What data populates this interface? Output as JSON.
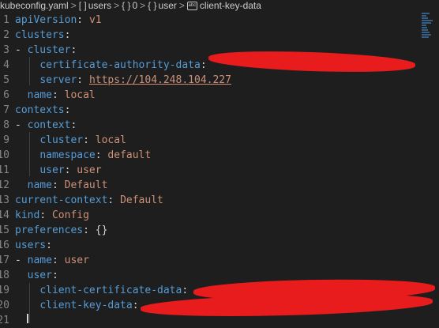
{
  "breadcrumb": {
    "file": "kubeconfig.yaml",
    "items": [
      {
        "symbol": "[ ]",
        "label": "users"
      },
      {
        "symbol": "{ }",
        "label": "0"
      },
      {
        "symbol": "{ }",
        "label": "user"
      },
      {
        "symbol": "abc",
        "label": "client-key-data"
      }
    ]
  },
  "lines": [
    {
      "num": "1",
      "parts": [
        {
          "t": "k",
          "s": "apiVersion"
        },
        {
          "t": "p",
          "s": ": "
        },
        {
          "t": "v",
          "s": "v1"
        }
      ]
    },
    {
      "num": "2",
      "parts": [
        {
          "t": "k",
          "s": "clusters"
        },
        {
          "t": "p",
          "s": ":"
        }
      ]
    },
    {
      "num": "3",
      "parts": [
        {
          "t": "p",
          "s": "- "
        },
        {
          "t": "k",
          "s": "cluster"
        },
        {
          "t": "p",
          "s": ":"
        }
      ]
    },
    {
      "num": "4",
      "parts": [
        {
          "t": "p",
          "s": "    "
        },
        {
          "t": "k",
          "s": "certificate-authority-data"
        },
        {
          "t": "p",
          "s": ":"
        }
      ]
    },
    {
      "num": "5",
      "parts": [
        {
          "t": "p",
          "s": "    "
        },
        {
          "t": "k",
          "s": "server"
        },
        {
          "t": "p",
          "s": ": "
        },
        {
          "t": "u",
          "s": "https://104.248.104.227"
        }
      ]
    },
    {
      "num": "6",
      "parts": [
        {
          "t": "p",
          "s": "  "
        },
        {
          "t": "k",
          "s": "name"
        },
        {
          "t": "p",
          "s": ": "
        },
        {
          "t": "v",
          "s": "local"
        }
      ]
    },
    {
      "num": "7",
      "parts": [
        {
          "t": "k",
          "s": "contexts"
        },
        {
          "t": "p",
          "s": ":"
        }
      ]
    },
    {
      "num": "8",
      "parts": [
        {
          "t": "p",
          "s": "- "
        },
        {
          "t": "k",
          "s": "context"
        },
        {
          "t": "p",
          "s": ":"
        }
      ]
    },
    {
      "num": "9",
      "parts": [
        {
          "t": "p",
          "s": "    "
        },
        {
          "t": "k",
          "s": "cluster"
        },
        {
          "t": "p",
          "s": ": "
        },
        {
          "t": "v",
          "s": "local"
        }
      ]
    },
    {
      "num": "10",
      "parts": [
        {
          "t": "p",
          "s": "    "
        },
        {
          "t": "k",
          "s": "namespace"
        },
        {
          "t": "p",
          "s": ": "
        },
        {
          "t": "v",
          "s": "default"
        }
      ]
    },
    {
      "num": "11",
      "parts": [
        {
          "t": "p",
          "s": "    "
        },
        {
          "t": "k",
          "s": "user"
        },
        {
          "t": "p",
          "s": ": "
        },
        {
          "t": "v",
          "s": "user"
        }
      ]
    },
    {
      "num": "12",
      "parts": [
        {
          "t": "p",
          "s": "  "
        },
        {
          "t": "k",
          "s": "name"
        },
        {
          "t": "p",
          "s": ": "
        },
        {
          "t": "v",
          "s": "Default"
        }
      ]
    },
    {
      "num": "13",
      "parts": [
        {
          "t": "k",
          "s": "current-context"
        },
        {
          "t": "p",
          "s": ": "
        },
        {
          "t": "v",
          "s": "Default"
        }
      ]
    },
    {
      "num": "14",
      "parts": [
        {
          "t": "k",
          "s": "kind"
        },
        {
          "t": "p",
          "s": ": "
        },
        {
          "t": "v",
          "s": "Config"
        }
      ]
    },
    {
      "num": "15",
      "parts": [
        {
          "t": "k",
          "s": "preferences"
        },
        {
          "t": "p",
          "s": ": {}"
        }
      ]
    },
    {
      "num": "16",
      "parts": [
        {
          "t": "k",
          "s": "users"
        },
        {
          "t": "p",
          "s": ":"
        }
      ]
    },
    {
      "num": "17",
      "parts": [
        {
          "t": "p",
          "s": "- "
        },
        {
          "t": "k",
          "s": "name"
        },
        {
          "t": "p",
          "s": ": "
        },
        {
          "t": "v",
          "s": "user"
        }
      ]
    },
    {
      "num": "18",
      "parts": [
        {
          "t": "p",
          "s": "  "
        },
        {
          "t": "k",
          "s": "user"
        },
        {
          "t": "p",
          "s": ":"
        }
      ]
    },
    {
      "num": "19",
      "parts": [
        {
          "t": "p",
          "s": "    "
        },
        {
          "t": "k",
          "s": "client-certificate-data"
        },
        {
          "t": "p",
          "s": ":"
        }
      ]
    },
    {
      "num": "20",
      "parts": [
        {
          "t": "p",
          "s": "    "
        },
        {
          "t": "k",
          "s": "client-key-data"
        },
        {
          "t": "p",
          "s": ":"
        }
      ]
    },
    {
      "num": "21",
      "parts": []
    }
  ],
  "colors": {
    "background": "#1e1e1e",
    "key": "#569cd6",
    "value": "#ce9178",
    "line_number": "#858585",
    "redaction": "#e81c1c"
  }
}
